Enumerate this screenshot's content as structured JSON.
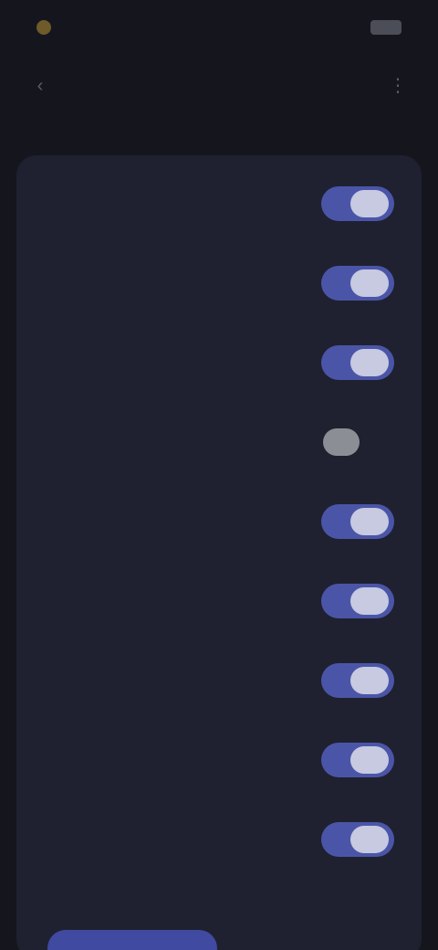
{
  "status_bar": {
    "time": "",
    "battery": ""
  },
  "header": {
    "title": "",
    "back_icon": "chevron-left-icon",
    "menu_icon": "more-icon"
  },
  "section": {
    "label": ""
  },
  "settings": [
    {
      "label": "",
      "enabled": true
    },
    {
      "label": "",
      "enabled": true
    },
    {
      "label": "",
      "enabled": true
    },
    {
      "label": "",
      "enabled": false
    },
    {
      "label": "",
      "enabled": true
    },
    {
      "label": "",
      "enabled": true
    },
    {
      "label": "",
      "enabled": true
    },
    {
      "label": "",
      "enabled": true
    },
    {
      "label": "",
      "enabled": true
    }
  ],
  "footer": {
    "label": "",
    "button_label": ""
  },
  "colors": {
    "background": "#15161d",
    "card": "#1f2130",
    "accent": "#4b55a8",
    "knob": "#c7cae0"
  }
}
